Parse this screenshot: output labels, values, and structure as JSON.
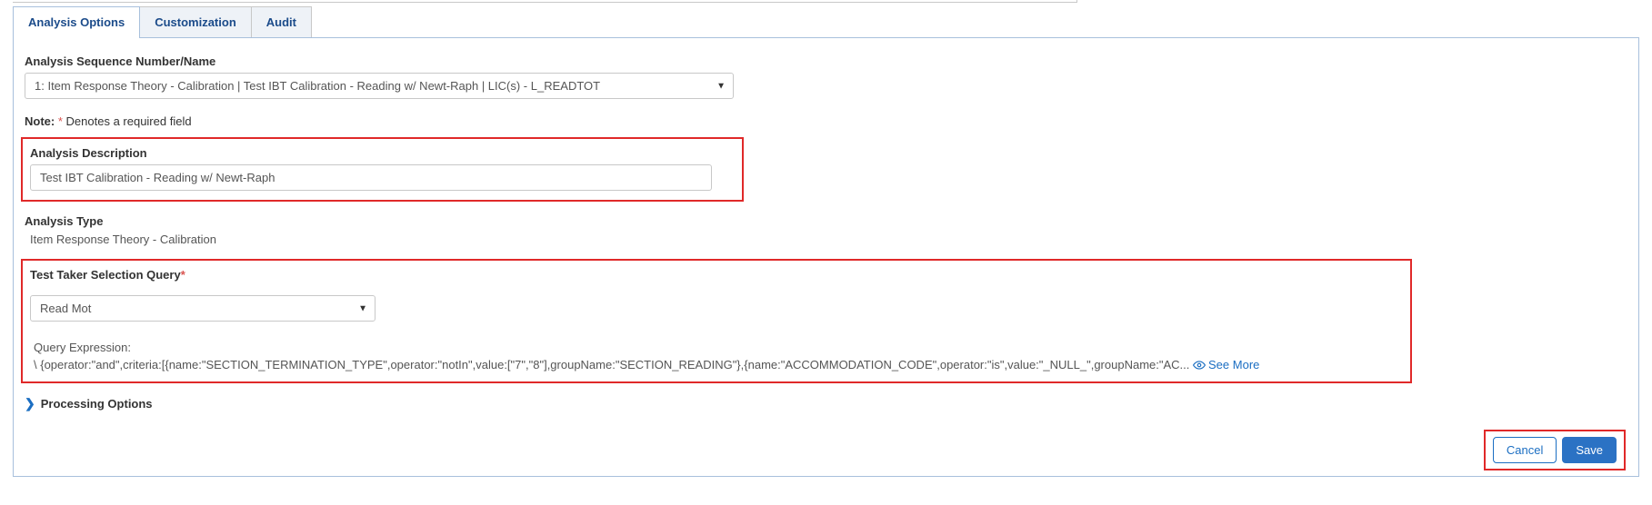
{
  "tabs": {
    "analysis_options": "Analysis Options",
    "customization": "Customization",
    "audit": "Audit"
  },
  "form": {
    "seq_label": "Analysis Sequence Number/Name",
    "seq_value": "1: Item Response Theory - Calibration | Test IBT Calibration - Reading w/ Newt-Raph | LIC(s) - L_READTOT",
    "note_prefix": "Note:",
    "note_star": "*",
    "note_suffix": "Denotes a required field",
    "desc_label": "Analysis Description",
    "desc_value": "Test IBT Calibration - Reading w/ Newt-Raph",
    "type_label": "Analysis Type",
    "type_value": "Item Response Theory - Calibration",
    "query_label": "Test Taker Selection Query",
    "query_select_value": "Read Mot",
    "query_expr_label": "Query Expression:",
    "query_expr_value": "\\ {operator:\"and\",criteria:[{name:\"SECTION_TERMINATION_TYPE\",operator:\"notIn\",value:[\"7\",\"8\"],groupName:\"SECTION_READING\"},{name:\"ACCOMMODATION_CODE\",operator:\"is\",value:\"_NULL_\",groupName:\"AC...",
    "see_more": "See More",
    "processing_options": "Processing Options"
  },
  "footer": {
    "cancel": "Cancel",
    "save": "Save"
  }
}
